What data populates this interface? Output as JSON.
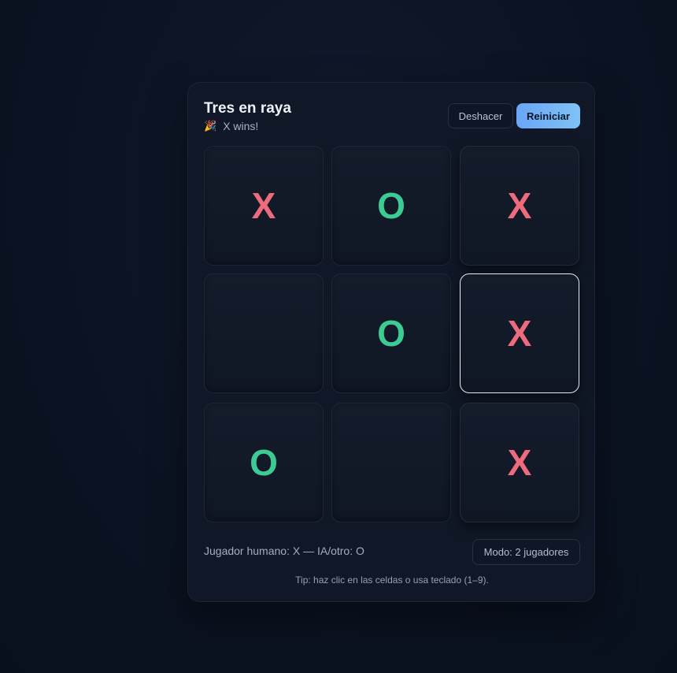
{
  "game": {
    "title": "Tres en raya",
    "status_icon": "party-popper-icon",
    "status_emoji": "🎉",
    "status_text": "X wins!",
    "undo_label": "Deshacer",
    "reset_label": "Reiniciar",
    "board": [
      [
        "X",
        "O",
        "X"
      ],
      [
        "",
        "O",
        "X"
      ],
      [
        "O",
        "",
        "X"
      ]
    ],
    "winning_line": [
      [
        0,
        2
      ],
      [
        1,
        2
      ],
      [
        2,
        2
      ]
    ],
    "focused_cell": [
      1,
      2
    ],
    "players_label": "Jugador humano: X — IA/otro: O",
    "mode_label": "Modo: 2 jugadores",
    "tip": "Tip: haz clic en las celdas o usa teclado (1–9).",
    "colors": {
      "x": "#ee6b7d",
      "o": "#3ccc93",
      "accent": "#6aa6f7"
    }
  }
}
